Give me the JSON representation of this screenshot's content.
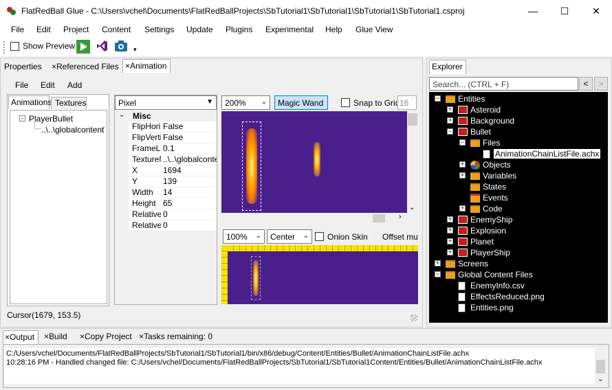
{
  "window": {
    "title": "FlatRedBall Glue - C:\\Users\\vchel\\Documents\\FlatRedBallProjects\\SbTutorial1\\SbTutorial1\\SbTutorial1\\SbTutorial1.csproj",
    "minimize_glyph": "—",
    "maximize_glyph": "☐",
    "close_glyph": "✕"
  },
  "menu": [
    "File",
    "Edit",
    "Project",
    "Content",
    "Settings",
    "Update",
    "Plugins",
    "Experimental",
    "Help",
    "Glue View"
  ],
  "toolbar": {
    "show_preview_label": "Show Preview",
    "show_preview_checked": false,
    "overflow_glyph": "▾"
  },
  "left_tabs": [
    {
      "label": "Properties",
      "closable": false
    },
    {
      "label": "Referenced Files",
      "closable": true
    },
    {
      "label": "Animation",
      "closable": true,
      "active": true
    }
  ],
  "close_glyph": "×",
  "animation_menu": [
    "File",
    "Edit",
    "Add"
  ],
  "animation_tree_tabs": [
    "Animations",
    "Textures"
  ],
  "animation_tree": {
    "root": "PlayerBullet",
    "child": "..\\..\\globalcontent\\"
  },
  "property_grid": {
    "unit_combo": "Pixel",
    "category": "Misc",
    "rows": [
      {
        "label": "FlipHorizontal",
        "value": "False"
      },
      {
        "label": "FlipVertical",
        "value": "False"
      },
      {
        "label": "FrameLength",
        "value": "0.1"
      },
      {
        "label": "TextureName",
        "value": "..\\..\\globalconte"
      },
      {
        "label": "X",
        "value": "1694"
      },
      {
        "label": "Y",
        "value": "139"
      },
      {
        "label": "Width",
        "value": "14"
      },
      {
        "label": "Height",
        "value": "65"
      },
      {
        "label": "Relative",
        "value": "0"
      },
      {
        "label": "Relative",
        "value": "0"
      }
    ]
  },
  "texture_view": {
    "zoom": "200%",
    "magic_wand_label": "Magic Wand",
    "snap_to_grid_label": "Snap to Grid",
    "snap_value": "16"
  },
  "preview_view": {
    "zoom": "100%",
    "alignment": "Center",
    "onion_skin_label": "Onion Skin",
    "offset_label": "Offset mult"
  },
  "status": {
    "cursor": "Cursor(1679, 153.5)"
  },
  "explorer": {
    "tab_label": "Explorer",
    "search_placeholder": "Search... (CTRL + F)",
    "back_glyph": "<",
    "forward_glyph": ">",
    "items": [
      {
        "label": "Entities",
        "depth": 0,
        "icon": "folder",
        "expander": "-"
      },
      {
        "label": "Asteroid",
        "depth": 1,
        "icon": "entity",
        "expander": "+"
      },
      {
        "label": "Background",
        "depth": 1,
        "icon": "entity",
        "expander": "+"
      },
      {
        "label": "Bullet",
        "depth": 1,
        "icon": "entity",
        "expander": "-"
      },
      {
        "label": "Files",
        "depth": 2,
        "icon": "folder",
        "expander": "-"
      },
      {
        "label": "AnimationChainListFile.achx",
        "depth": 3,
        "icon": "file",
        "expander": "",
        "selected": true
      },
      {
        "label": "Objects",
        "depth": 2,
        "icon": "objects",
        "expander": "+"
      },
      {
        "label": "Variables",
        "depth": 2,
        "icon": "folder",
        "expander": "+"
      },
      {
        "label": "States",
        "depth": 2,
        "icon": "folder",
        "expander": ""
      },
      {
        "label": "Events",
        "depth": 2,
        "icon": "events",
        "expander": ""
      },
      {
        "label": "Code",
        "depth": 2,
        "icon": "folder",
        "expander": "+"
      },
      {
        "label": "EnemyShip",
        "depth": 1,
        "icon": "entity",
        "expander": "+"
      },
      {
        "label": "Explosion",
        "depth": 1,
        "icon": "entity",
        "expander": "+"
      },
      {
        "label": "Planet",
        "depth": 1,
        "icon": "entity",
        "expander": "+"
      },
      {
        "label": "PlayerShip",
        "depth": 1,
        "icon": "entity",
        "expander": "+"
      },
      {
        "label": "Screens",
        "depth": 0,
        "icon": "folder",
        "expander": "+"
      },
      {
        "label": "Global Content Files",
        "depth": 0,
        "icon": "folder",
        "expander": "-"
      },
      {
        "label": "EnemyInfo.csv",
        "depth": 1,
        "icon": "file",
        "expander": ""
      },
      {
        "label": "EffectsReduced.png",
        "depth": 1,
        "icon": "file",
        "expander": ""
      },
      {
        "label": "Entities.png",
        "depth": 1,
        "icon": "file",
        "expander": ""
      }
    ]
  },
  "bottom_tabs": [
    {
      "label": "Output",
      "active": true
    },
    {
      "label": "Build"
    },
    {
      "label": "Copy Project"
    },
    {
      "label": "Tasks remaining: 0"
    }
  ],
  "output_lines": [
    "C:/Users/vchel/Documents/FlatRedBallProjects/SbTutorial1/SbTutorial1/bin/x86/debug/Content/Entities/Bullet/AnimationChainListFile.achx",
    "10:28:16 PM - Handled changed file: C:/Users/vchel/Documents/FlatRedBallProjects/SbTutorial1/SbTutorial1Content/Entities/Bullet/AnimationChainListFile.achx"
  ],
  "colors": {
    "canvas_bg": "#4a1f8c",
    "explorer_bg": "#000000",
    "selection_bg": "#ffffff",
    "ruler": "#f5e400",
    "bullet_glow": "#ffb000"
  }
}
